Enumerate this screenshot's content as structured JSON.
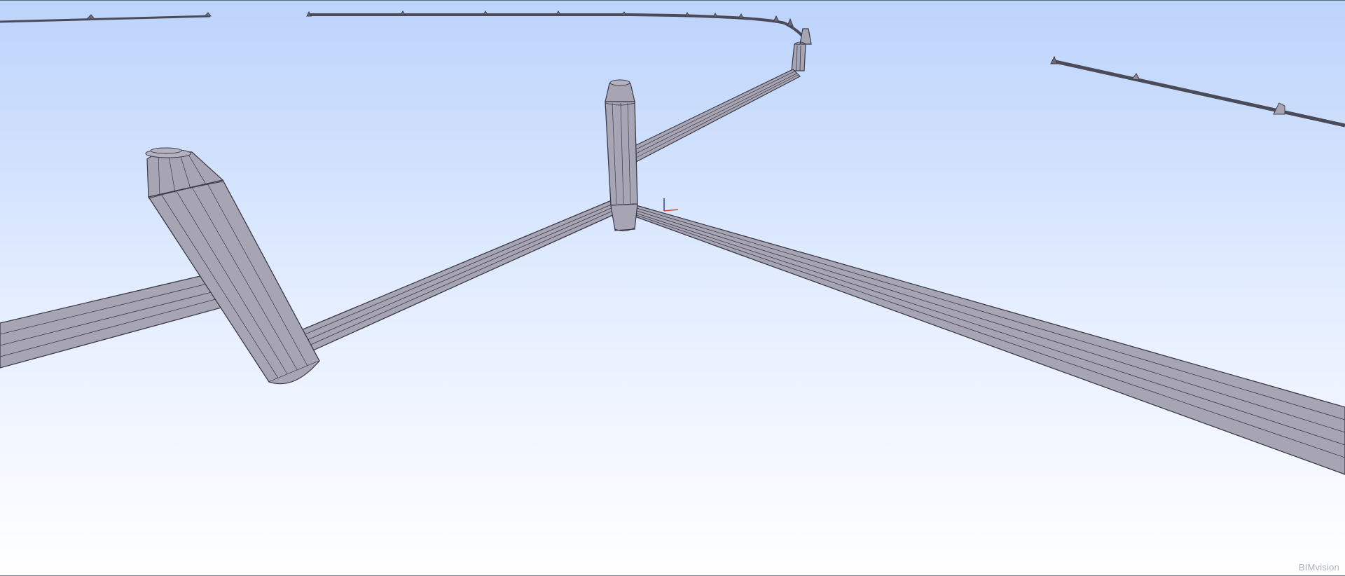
{
  "viewer": {
    "watermark": "BIMvision",
    "background_top_color": "#bcd3fb",
    "background_bottom_color": "#ffffff",
    "pipe_fill_color": "#a7a5b3",
    "pipe_edge_color": "#3a3a48",
    "axis_x_color": "#e04040",
    "axis_y_color": "#2040a0"
  }
}
